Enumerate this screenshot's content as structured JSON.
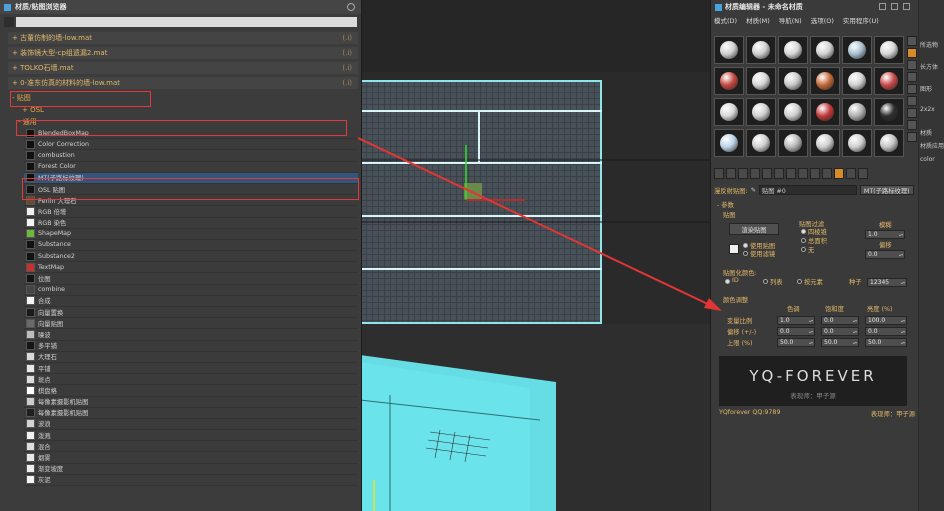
{
  "browser": {
    "title": "材质/贴图浏览器",
    "materials": [
      {
        "name": "+ 古董仿制的墙-low.mat",
        "lock": "(.i)"
      },
      {
        "name": "+ 装饰镜大型-cp组遗漏2.mat",
        "lock": "(.i)"
      },
      {
        "name": "+ TOLKO石墙.mat",
        "lock": "(.i)"
      },
      {
        "name": "+ 0-准东仿真的材料的墙-low.mat",
        "lock": "(.i)"
      }
    ],
    "cat_maps": "- 贴图",
    "cat_osl": "+ OSL",
    "cat_general": "- 通用",
    "maps": [
      {
        "label": "BlendedBoxMap",
        "color": "#111111"
      },
      {
        "label": "Color Correction",
        "color": "#101010"
      },
      {
        "label": "combustion",
        "color": "#111111"
      },
      {
        "label": "Forest Color",
        "color": "#111111"
      },
      {
        "label": "MT(子路标纹理)",
        "color": "#0f0f0f"
      },
      {
        "label": "OSL 贴图",
        "color": "#141414"
      },
      {
        "label": "Perlin 大理石",
        "color": "#6b4a2e"
      },
      {
        "label": "RGB 倍增",
        "color": "#f0f0f0"
      },
      {
        "label": "RGB 染色",
        "color": "#f4f4f4"
      },
      {
        "label": "ShapeMap",
        "color": "#6bbb3a"
      },
      {
        "label": "Substance",
        "color": "#121212"
      },
      {
        "label": "Substance2",
        "color": "#121212"
      },
      {
        "label": "TextMap",
        "color": "#c83030"
      },
      {
        "label": "位图",
        "color": "#141414"
      },
      {
        "label": "combine",
        "color": "#454545"
      },
      {
        "label": "合成",
        "color": "#f4f4f4"
      },
      {
        "label": "向量置换",
        "color": "#1a1a1a"
      },
      {
        "label": "向量贴图",
        "color": "#6a6a6a"
      },
      {
        "label": "噪波",
        "color": "#bdbdbd"
      },
      {
        "label": "多平铺",
        "color": "#151515"
      },
      {
        "label": "大理石",
        "color": "#d9d9d9"
      },
      {
        "label": "平铺",
        "color": "#e8e8e8"
      },
      {
        "label": "斑点",
        "color": "#dddddd"
      },
      {
        "label": "棋盘格",
        "color": "#ffffff"
      },
      {
        "label": "每像素摄影机贴图",
        "color": "#cccccc"
      },
      {
        "label": "每像素摄影机贴图",
        "color": "#1f1f1f"
      },
      {
        "label": "波浪",
        "color": "#d4d4d4"
      },
      {
        "label": "泼溅",
        "color": "#f2f2f2"
      },
      {
        "label": "混合",
        "color": "#dedede"
      },
      {
        "label": "烟雾",
        "color": "#e8e8e8"
      },
      {
        "label": "渐变坡度",
        "color": "#ededed"
      },
      {
        "label": "灰泥",
        "color": "#f4f4f4"
      }
    ]
  },
  "mateditor": {
    "title": "材质编辑器 - 未命名材质",
    "menu": [
      "模式(D)",
      "材质(M)",
      "导航(N)",
      "选项(O)",
      "实用程序(U)"
    ],
    "sphere_colors": [
      "#d0d0d0",
      "#cfcfcf",
      "#d6d6d6",
      "#d2d2d2",
      "#a9c0d1",
      "#d6d6d6",
      "#c54a42",
      "#d7d7d7",
      "#c9c9c9",
      "#c46a3a",
      "#d2d2d2",
      "#c94b4b",
      "#d8d8d8",
      "#d0d0d0",
      "#cfcfcf",
      "#c43a3a",
      "#b0b0b0",
      "#2e2e2e",
      "#bcd3e6",
      "#cfcfcf",
      "#b8b8b8",
      "#cdcdcd",
      "#cfcfcf",
      "#c5c5c5"
    ],
    "name_label": "漫反射贴图:",
    "map_name": "贴图 #0",
    "map_type": "MT(子路标纹理)",
    "rollout_params": "- 参数",
    "group_map": "贴图",
    "choose_map_button": "渲染贴图",
    "map_output": "贴图过滤",
    "output_options": [
      "四棱锥",
      "总面积",
      "无"
    ],
    "chk_use_map": "使用贴图",
    "chk_use_filter": "使用滤镜",
    "blur_label": "模糊",
    "blur_value": "1.0",
    "offset_label": "偏移",
    "offset_value": "0.0",
    "random_label": "贴图化颜色:",
    "random_options": [
      "ID",
      "列表",
      "按元素"
    ],
    "seed_label": "种子",
    "seed_value": "12345",
    "color_adjust_label": "颜色调整",
    "col_heads": [
      "色调",
      "饱和度",
      "亮度 (%)"
    ],
    "row_labels": [
      "变量比例",
      "偏移 (+/-)",
      "上限 (%)"
    ],
    "grid_values": [
      [
        "1.0",
        "0.0",
        "100.0"
      ],
      [
        "0.0",
        "0.0",
        "0.0"
      ],
      [
        "50.0",
        "50.0",
        "50.0"
      ]
    ],
    "banner_big": "YQ-FOREVER",
    "banner_small": "表现师：甲子源",
    "footer_left": "YQforever QQ:9789",
    "footer_right": "表现师：甲子源"
  },
  "rightstrip": [
    "所选物",
    "长方体",
    "图形",
    "2x2x",
    "材质",
    "材质应用",
    "color"
  ]
}
